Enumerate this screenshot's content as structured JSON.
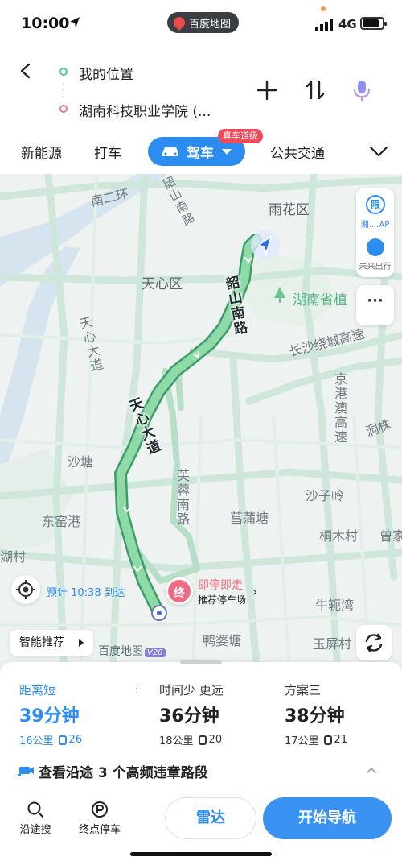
{
  "status_bar": {
    "time": "10:00",
    "app_pill": "百度地图",
    "network": "4G"
  },
  "route": {
    "origin": "我的位置",
    "destination": "湖南科技职业学院 (..."
  },
  "modes": {
    "items": [
      "新能源",
      "打车",
      "驾车",
      "公共交通"
    ],
    "active": "驾车",
    "badge": "真车道级"
  },
  "map": {
    "labels": {
      "yuhua": "雨花区",
      "nanerhuan": "南二环",
      "shaoshan_top": "韶山南路",
      "tianxin": "天心区",
      "tianxin_dadao_side": "天心大道",
      "hunan_botanic": "湖南省植",
      "changsha_highway": "长沙绕城高速",
      "jinggang_highway": "京港澳高速",
      "zhuzhu": "洞株",
      "shatang": "沙塘",
      "shaziling": "沙子岭",
      "dongyaogang": "东窑港",
      "furong": "芙蓉南路",
      "pumatang": "菖蒲塘",
      "fangmucun": "桐木村",
      "caojia": "曾家",
      "hucun": "湖村",
      "niuwan": "牛轭湾",
      "yapotang": "鸭婆塘",
      "yupingcun": "玉屏村"
    },
    "route_roads": [
      "韶山南路",
      "天心大道"
    ],
    "side_panel": {
      "limit_icon": "限",
      "limit_label": "湘....AP",
      "future_label": "未来出行",
      "more": "···"
    },
    "eta": "预计 10:38 到达",
    "parking": {
      "end_marker": "终",
      "title": "即停即走",
      "subtitle": "推荐停车场"
    },
    "smart_recommend": "智能推荐",
    "logo": "百度地图",
    "logo_version": "V20"
  },
  "plans": [
    {
      "label": "距离短",
      "duration": "39分钟",
      "distance": "16公里",
      "lights": "26",
      "more": "⋮"
    },
    {
      "label": "时间少 更远",
      "duration": "36分钟",
      "distance": "18公里",
      "lights": "20"
    },
    {
      "label": "方案三",
      "duration": "38分钟",
      "distance": "17公里",
      "lights": "21"
    }
  ],
  "violation_text": "查看沿途 3 个高频违章路段",
  "bottom_bar": {
    "search_along": "沿途搜",
    "end_parking": "终点停车",
    "radar": "雷达",
    "start_nav": "开始导航"
  },
  "colors": {
    "accent": "#2d8cf0",
    "route": "#7ed29a",
    "end_marker": "#f16b80"
  }
}
